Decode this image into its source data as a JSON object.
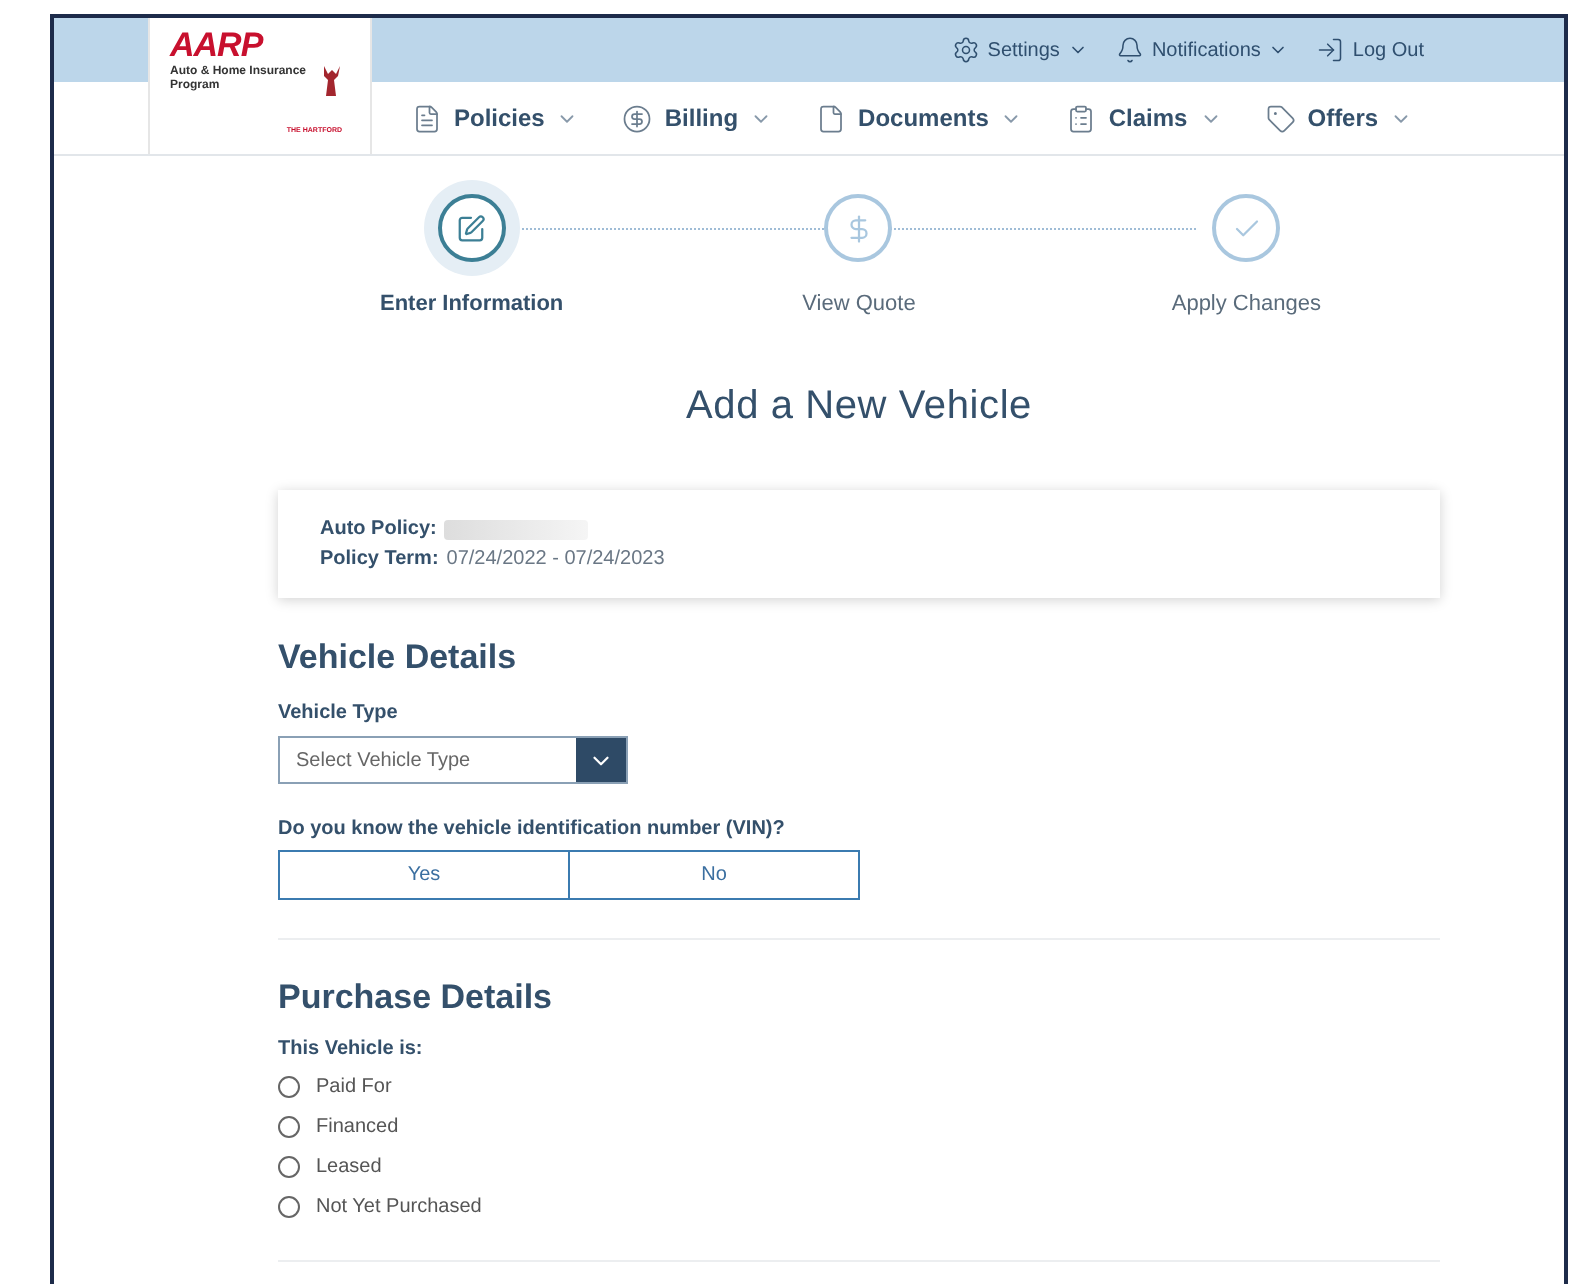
{
  "header": {
    "logo": {
      "brand": "AARP",
      "program": "Auto & Home Insurance Program",
      "partner": "THE HARTFORD"
    },
    "utility_links": [
      {
        "label": "Settings",
        "kind": "menu"
      },
      {
        "label": "Notifications",
        "kind": "menu"
      },
      {
        "label": "Log Out",
        "kind": "link"
      }
    ],
    "nav": [
      {
        "label": "Policies"
      },
      {
        "label": "Billing"
      },
      {
        "label": "Documents"
      },
      {
        "label": "Claims"
      },
      {
        "label": "Offers"
      }
    ]
  },
  "steps": [
    {
      "label": "Enter Information",
      "selected": true
    },
    {
      "label": "View Quote",
      "selected": false
    },
    {
      "label": "Apply Changes",
      "selected": false
    }
  ],
  "title": "Add a New Vehicle",
  "policy_card": {
    "fields": [
      {
        "label": "Auto Policy:",
        "redacted": true
      },
      {
        "label": "Policy Term:",
        "value": "07/24/2022 - 07/24/2023",
        "redacted": false
      }
    ]
  },
  "vehicle_details": {
    "heading": "Vehicle Details",
    "vehicle_type": {
      "label": "Vehicle Type",
      "placeholder": "Select Vehicle Type"
    },
    "vin_question": {
      "label": "Do you know the vehicle identification number (VIN)?",
      "options": [
        {
          "label": "Yes",
          "selected": false
        },
        {
          "label": "No",
          "selected": false
        }
      ]
    }
  },
  "purchase_details": {
    "heading": "Purchase Details",
    "label": "This Vehicle is:",
    "options": [
      {
        "label": "Paid For",
        "selected": false
      },
      {
        "label": "Financed",
        "selected": false
      },
      {
        "label": "Leased",
        "selected": false
      },
      {
        "label": "Not Yet Purchased",
        "selected": false
      }
    ]
  }
}
